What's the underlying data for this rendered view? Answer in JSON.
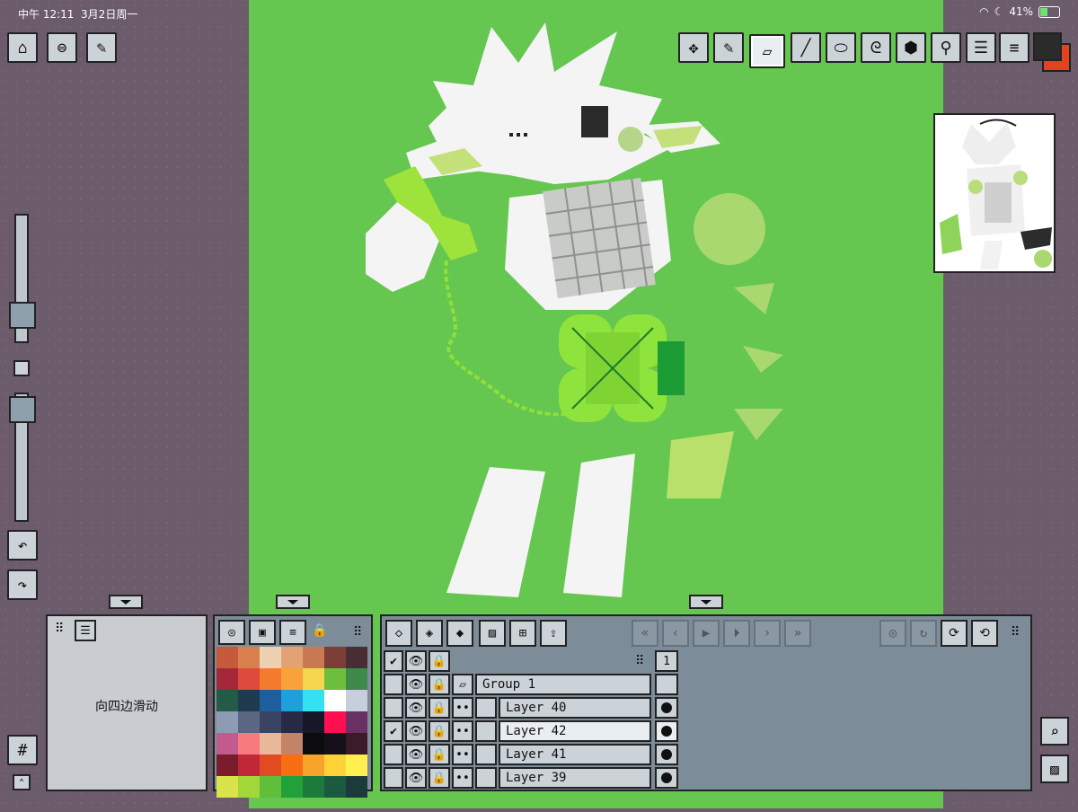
{
  "status_bar": {
    "time": "中午 12:11",
    "date": "3月2日周一",
    "battery": "41%"
  },
  "left_toolbar": {
    "icons": [
      "home-icon",
      "swirl-icon",
      "wrench-icon"
    ]
  },
  "top_tools": {
    "icons": [
      "move-icon",
      "pencil-icon",
      "eraser-icon",
      "line-icon",
      "ellipse-icon",
      "lasso-icon",
      "fill-icon",
      "eyedropper-icon",
      "layers-adjust-icon",
      "menu-icon"
    ],
    "selected": "eraser-icon"
  },
  "colors": {
    "canvas_bg": "#65c650",
    "primary": "#2b2b2b",
    "secondary": "#e5421f"
  },
  "info_panel": {
    "text": "向四边滑动"
  },
  "palette": {
    "swatches": [
      "#c65a3b",
      "#d9804c",
      "#ecd2b2",
      "#e3a273",
      "#c97a52",
      "#7d3e37",
      "#4a2c33",
      "#a5283a",
      "#de4b3c",
      "#f47a2e",
      "#f9a13a",
      "#f7d64f",
      "#6fbf3f",
      "#3f8a4a",
      "#245a48",
      "#1f3b4f",
      "#1d5e9c",
      "#1fa0dd",
      "#35e0f0",
      "#ffffff",
      "#c7cfdc",
      "#8d9bb3",
      "#596783",
      "#3a4363",
      "#262a44",
      "#16182a",
      "#ff0f4f",
      "#6b3063",
      "#c25a8d",
      "#f77a7d",
      "#e8b89a",
      "#c28366",
      "#0b0b10",
      "#15101a",
      "#3c1b29",
      "#7a1c2b",
      "#c0283a",
      "#e24a22",
      "#f96d13",
      "#f7a42a",
      "#ffd23a",
      "#ffef4f",
      "#d9e34a",
      "#a3d63a",
      "#5fbf3a",
      "#22a03a",
      "#1c7a3a",
      "#1c5a3f",
      "#1c3a3a"
    ]
  },
  "layers": {
    "count_badge": "1",
    "rows": [
      {
        "name": "Group 1",
        "checked": false,
        "type": "group",
        "active": false
      },
      {
        "name": "Layer 40",
        "checked": false,
        "type": "layer",
        "active": false
      },
      {
        "name": "Layer 42",
        "checked": true,
        "type": "layer",
        "active": true
      },
      {
        "name": "Layer 41",
        "checked": false,
        "type": "layer",
        "active": false
      },
      {
        "name": "Layer 39",
        "checked": false,
        "type": "layer",
        "active": false
      }
    ]
  }
}
